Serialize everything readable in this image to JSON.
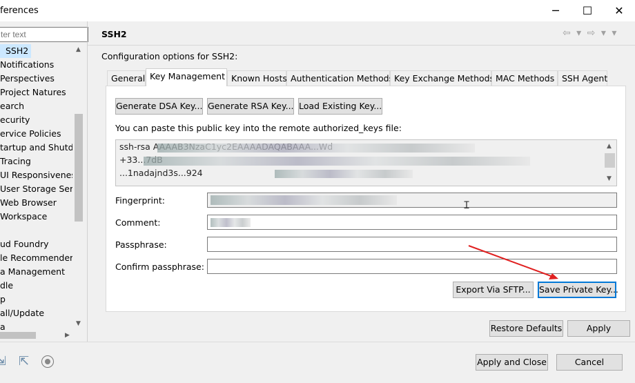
{
  "window": {
    "title": "ferences",
    "minimize_glyph": "─",
    "maximize_glyph": "☐",
    "close_glyph": "✕"
  },
  "sidebar": {
    "filter_placeholder": "ter text",
    "items": [
      {
        "label": "SSH2",
        "selected": true
      },
      {
        "label": "Notifications"
      },
      {
        "label": "Perspectives"
      },
      {
        "label": "Project Natures"
      },
      {
        "label": "earch"
      },
      {
        "label": "ecurity"
      },
      {
        "label": "ervice Policies"
      },
      {
        "label": "tartup and Shutdo"
      },
      {
        "label": "Tracing"
      },
      {
        "label": "UI Responsiveness"
      },
      {
        "label": "User Storage Servic"
      },
      {
        "label": "Web Browser"
      },
      {
        "label": "Workspace"
      },
      {
        "label": ""
      },
      {
        "label": "ud Foundry"
      },
      {
        "label": "le Recommenders"
      },
      {
        "label": "a Management"
      },
      {
        "label": "dle"
      },
      {
        "label": "p"
      },
      {
        "label": "all/Update"
      },
      {
        "label": "a"
      }
    ]
  },
  "page": {
    "title": "SSH2",
    "description": "Configuration options for SSH2:",
    "nav_icons": "⇦ ▾ ⇨ ▾ ▾"
  },
  "tabs": [
    {
      "label": "General"
    },
    {
      "label": "Key Management",
      "active": true
    },
    {
      "label": "Known Hosts"
    },
    {
      "label": "Authentication Methods"
    },
    {
      "label": "Key Exchange Methods"
    },
    {
      "label": "MAC Methods"
    },
    {
      "label": "SSH Agent"
    }
  ],
  "key_management": {
    "generate_dsa": "Generate DSA Key...",
    "generate_rsa": "Generate RSA Key...",
    "load_existing": "Load Existing Key...",
    "paste_hint": "You can paste this public key into the remote authorized_keys file:",
    "key_lines": [
      "ssh-rsa AAAAB3NzaC1yc2EAAAADAQABAAA...Wd",
      "+33...7dB",
      "...1nadajnd3s...924"
    ],
    "fingerprint_label": "Fingerprint:",
    "comment_label": "Comment:",
    "passphrase_label": "Passphrase:",
    "confirm_label": "Confirm passphrase:",
    "export_button": "Export Via SFTP...",
    "save_button": "Save Private Key..."
  },
  "footer": {
    "restore_defaults": "Restore Defaults",
    "apply": "Apply",
    "apply_close": "Apply and Close",
    "cancel": "Cancel"
  },
  "colors": {
    "accent": "#0078d7",
    "selection": "#cce8ff",
    "annotation_arrow": "#e02020"
  }
}
